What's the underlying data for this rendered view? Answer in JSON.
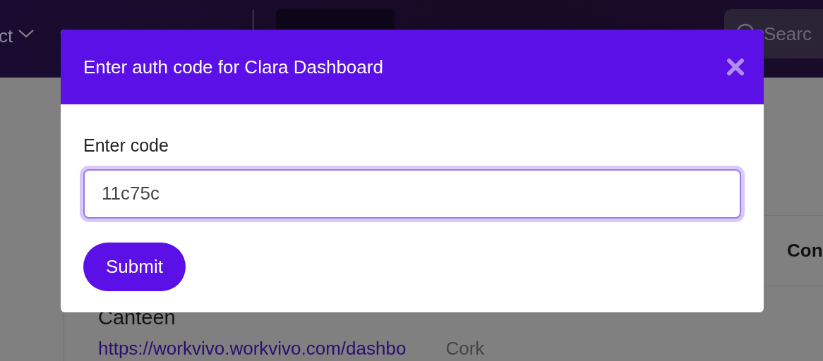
{
  "navbar": {
    "menu_label": "ct",
    "search": {
      "placeholder": "Searc"
    }
  },
  "table": {
    "column_header": "Con",
    "rows": [
      {
        "title": "Canteen",
        "link": "https://workvivo.workvivo.com/dashbo",
        "location": "Cork"
      }
    ]
  },
  "modal": {
    "title": "Enter auth code for Clara Dashboard",
    "field_label": "Enter code",
    "value": "11c75c",
    "focused": true,
    "submit": "Submit"
  }
}
